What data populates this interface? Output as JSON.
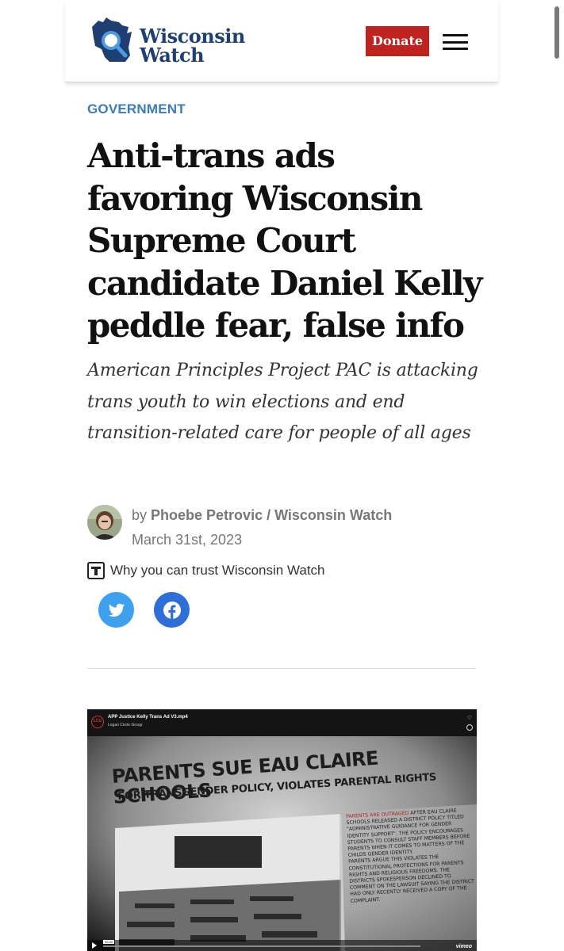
{
  "header": {
    "logo_line1": "Wisconsin",
    "logo_line2": "Watch",
    "donate_label": "Donate",
    "menu_icon": "hamburger-menu-icon"
  },
  "article": {
    "category": "GOVERNMENT",
    "headline": "Anti-trans ads favoring Wisconsin Supreme Court candidate Daniel Kelly peddle fear, false info",
    "dek": "American Principles Project PAC is attacking trans youth to win elections and end transition-related care for people of all ages",
    "byline_prefix": "by",
    "author": "Phoebe Petrovic / Wisconsin Watch",
    "date": "March 31st, 2023",
    "trust_label": "Why you can trust Wisconsin Watch"
  },
  "social": {
    "twitter_icon": "twitter-icon",
    "facebook_icon": "facebook-icon",
    "twitter_color": "#3fa1ee",
    "facebook_color": "#2d6fd6"
  },
  "video": {
    "file_title": "APP Justice Kelly Trans Ad V3.mp4",
    "channel": "Logan Circle Group",
    "channel_badge": "LCG",
    "ad_headline": "PARENTS SUE EAU CLAIRE SCHOOLS",
    "ad_subheadline": "FOR TRANSGENDER POLICY, VIOLATES PARENTAL RIGHTS",
    "ad_body_red": "PARENTS ARE OUTRAGED",
    "ad_body_1": "AFTER EAU CLAIRE SCHOOLS RELEASED A DISTRICT POLICY TITLED \"ADMINISTRATIVE GUIDANCE FOR GENDER IDENTITY SUPPORT\". THE POLICY ENCOURAGES STUDENTS TO CONSULT STAFF MEMBERS BEFORE PARENTS WHEN IT COMES TO MATTERS OF THE CHILDS GENDER IDENTITY.",
    "ad_body_2": "PARENTS ARGUE THIS VIOLATES THE CONSTITUTIONAL PROTECTIONS FOR PARENTS RIGHTS AND RELIGIOUS FREEDOMS. THE DISTRICTS SPOKESPERSON DECLINED TO COMMENT ON THE LAWSUIT SAYING THE DISTRICT HAD ONLY RECENTLY RECEIVED A COPY OF THE COMPLAINT.",
    "time_label": "00:40",
    "player_brand": "vimeo"
  },
  "colors": {
    "brand_blue": "#1f3f73",
    "donate_red": "#bf2320",
    "category_blue": "#3b7bb8"
  }
}
